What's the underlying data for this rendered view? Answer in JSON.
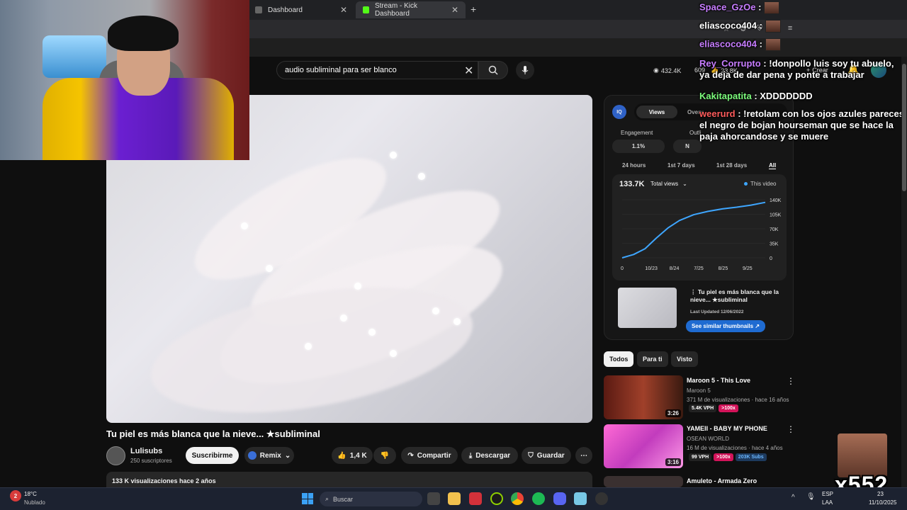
{
  "browser": {
    "tabs": [
      {
        "label": "Dashboard",
        "icon": "tab-icon"
      },
      {
        "label": "Stream - Kick Dashboard",
        "icon": "kick-icon"
      }
    ],
    "new_tab": "+"
  },
  "youtube": {
    "search": {
      "value": "audio subliminal para ser blanco"
    },
    "header_stats": {
      "views": "432.4K",
      "watching": "609",
      "likes": "23.8K",
      "create_label": "Crear"
    },
    "video": {
      "title": "Tu piel es más blanca que la nieve... ★subliminal",
      "channel": "Lulisubs",
      "subscribers": "250 suscriptores",
      "subscribe_label": "Suscribirme",
      "remix_label": "Remix",
      "likes": "1,4 K",
      "share_label": "Compartir",
      "download_label": "Descargar",
      "save_label": "Guardar",
      "description": "133 K visualizaciones  hace 2 años"
    },
    "analytics": {
      "tab_views": "Views",
      "tab_overview": "Overv",
      "engagement_label": "Engagement",
      "engagement_value": "1.1%",
      "outlier_label": "Outli",
      "outlier_value": "N",
      "ranges": [
        "24 hours",
        "1st 7 days",
        "1st 28 days",
        "All"
      ],
      "total": "133.7K",
      "total_select": "Total views",
      "legend": "This video",
      "thumb_title": "⋮ Tu piel es más blanca que la nieve... ★subliminal",
      "last_updated": "Last Updated 12/06/2022",
      "similar_button": "See similar thumbnails ↗"
    },
    "chips": [
      "Todos",
      "Para ti",
      "Visto"
    ],
    "recommendations": [
      {
        "title": "Maroon 5 - This Love",
        "channel": "Maroon 5",
        "meta": "371 M de visualizaciones · hace 16 años",
        "vph": "5.4K VPH",
        "badge": ">100x",
        "duration": "3:26"
      },
      {
        "title": "YAMEII - BABY MY PHONE",
        "channel": "OSEAN WORLD",
        "meta": "16 M de visualizaciones · hace 4 años",
        "vph": "99 VPH",
        "badge": ">100x",
        "subs": "203K Subs",
        "duration": "3:16"
      },
      {
        "title": "Amuleto - Armada Zero",
        "channel": "",
        "meta": "",
        "duration": ""
      }
    ]
  },
  "chart_data": {
    "type": "line",
    "title": "",
    "x_tick_labels": [
      "0",
      "10/23",
      "8/24",
      "7/25",
      "8/25",
      "9/25"
    ],
    "y_tick_labels": [
      "0",
      "35K",
      "70K",
      "105K",
      "140K"
    ],
    "ylim": [
      0,
      140000
    ],
    "series": [
      {
        "name": "This video",
        "color": "#3ea6ff",
        "x": [
          0,
          0.08,
          0.16,
          0.24,
          0.32,
          0.4,
          0.5,
          0.6,
          0.7,
          0.8,
          0.9,
          1.0
        ],
        "values": [
          0,
          8000,
          22000,
          48000,
          72000,
          90000,
          104000,
          112000,
          118000,
          122000,
          127000,
          133700
        ]
      }
    ]
  },
  "chat": [
    {
      "user": "Space_GzOe",
      "user_color": "#c77dff",
      "text": ""
    },
    {
      "user": "eliascoco404",
      "user_color": "#ffffff",
      "text": ""
    },
    {
      "user": "eliascoco404",
      "user_color": "#c77dff",
      "text": ""
    },
    {
      "user": "Rey_Corrupto",
      "user_color": "#c77dff",
      "text": "!donpollo luis soy tu abuelo, ya deja de dar pena y ponte a trabajar"
    },
    {
      "user": "Kakitapatita",
      "user_color": "#7cfc7c",
      "text": "XDDDDDDD"
    },
    {
      "user": "weerurd",
      "user_color": "#ff5c5c",
      "text": "!retolam con los ojos azules pareces el negro de bojan hourseman que se hace la paja ahorcandose y se muere"
    }
  ],
  "overlay": {
    "counter": "x552"
  },
  "taskbar": {
    "weather_temp": "18°C",
    "weather_text": "Nublado",
    "weather_badge": "2",
    "search_placeholder": "Buscar",
    "lang_top": "ESP",
    "lang_bottom": "LAA",
    "time": "23",
    "date": "11/10/2025"
  }
}
